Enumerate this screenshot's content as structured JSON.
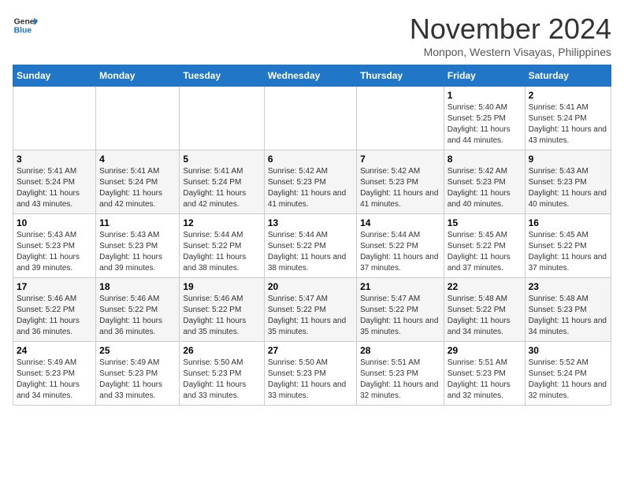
{
  "logo": {
    "line1": "General",
    "line2": "Blue"
  },
  "title": "November 2024",
  "location": "Monpon, Western Visayas, Philippines",
  "weekdays": [
    "Sunday",
    "Monday",
    "Tuesday",
    "Wednesday",
    "Thursday",
    "Friday",
    "Saturday"
  ],
  "weeks": [
    [
      {
        "day": "",
        "info": ""
      },
      {
        "day": "",
        "info": ""
      },
      {
        "day": "",
        "info": ""
      },
      {
        "day": "",
        "info": ""
      },
      {
        "day": "",
        "info": ""
      },
      {
        "day": "1",
        "info": "Sunrise: 5:40 AM\nSunset: 5:25 PM\nDaylight: 11 hours and 44 minutes."
      },
      {
        "day": "2",
        "info": "Sunrise: 5:41 AM\nSunset: 5:24 PM\nDaylight: 11 hours and 43 minutes."
      }
    ],
    [
      {
        "day": "3",
        "info": "Sunrise: 5:41 AM\nSunset: 5:24 PM\nDaylight: 11 hours and 43 minutes."
      },
      {
        "day": "4",
        "info": "Sunrise: 5:41 AM\nSunset: 5:24 PM\nDaylight: 11 hours and 42 minutes."
      },
      {
        "day": "5",
        "info": "Sunrise: 5:41 AM\nSunset: 5:24 PM\nDaylight: 11 hours and 42 minutes."
      },
      {
        "day": "6",
        "info": "Sunrise: 5:42 AM\nSunset: 5:23 PM\nDaylight: 11 hours and 41 minutes."
      },
      {
        "day": "7",
        "info": "Sunrise: 5:42 AM\nSunset: 5:23 PM\nDaylight: 11 hours and 41 minutes."
      },
      {
        "day": "8",
        "info": "Sunrise: 5:42 AM\nSunset: 5:23 PM\nDaylight: 11 hours and 40 minutes."
      },
      {
        "day": "9",
        "info": "Sunrise: 5:43 AM\nSunset: 5:23 PM\nDaylight: 11 hours and 40 minutes."
      }
    ],
    [
      {
        "day": "10",
        "info": "Sunrise: 5:43 AM\nSunset: 5:23 PM\nDaylight: 11 hours and 39 minutes."
      },
      {
        "day": "11",
        "info": "Sunrise: 5:43 AM\nSunset: 5:23 PM\nDaylight: 11 hours and 39 minutes."
      },
      {
        "day": "12",
        "info": "Sunrise: 5:44 AM\nSunset: 5:22 PM\nDaylight: 11 hours and 38 minutes."
      },
      {
        "day": "13",
        "info": "Sunrise: 5:44 AM\nSunset: 5:22 PM\nDaylight: 11 hours and 38 minutes."
      },
      {
        "day": "14",
        "info": "Sunrise: 5:44 AM\nSunset: 5:22 PM\nDaylight: 11 hours and 37 minutes."
      },
      {
        "day": "15",
        "info": "Sunrise: 5:45 AM\nSunset: 5:22 PM\nDaylight: 11 hours and 37 minutes."
      },
      {
        "day": "16",
        "info": "Sunrise: 5:45 AM\nSunset: 5:22 PM\nDaylight: 11 hours and 37 minutes."
      }
    ],
    [
      {
        "day": "17",
        "info": "Sunrise: 5:46 AM\nSunset: 5:22 PM\nDaylight: 11 hours and 36 minutes."
      },
      {
        "day": "18",
        "info": "Sunrise: 5:46 AM\nSunset: 5:22 PM\nDaylight: 11 hours and 36 minutes."
      },
      {
        "day": "19",
        "info": "Sunrise: 5:46 AM\nSunset: 5:22 PM\nDaylight: 11 hours and 35 minutes."
      },
      {
        "day": "20",
        "info": "Sunrise: 5:47 AM\nSunset: 5:22 PM\nDaylight: 11 hours and 35 minutes."
      },
      {
        "day": "21",
        "info": "Sunrise: 5:47 AM\nSunset: 5:22 PM\nDaylight: 11 hours and 35 minutes."
      },
      {
        "day": "22",
        "info": "Sunrise: 5:48 AM\nSunset: 5:22 PM\nDaylight: 11 hours and 34 minutes."
      },
      {
        "day": "23",
        "info": "Sunrise: 5:48 AM\nSunset: 5:23 PM\nDaylight: 11 hours and 34 minutes."
      }
    ],
    [
      {
        "day": "24",
        "info": "Sunrise: 5:49 AM\nSunset: 5:23 PM\nDaylight: 11 hours and 34 minutes."
      },
      {
        "day": "25",
        "info": "Sunrise: 5:49 AM\nSunset: 5:23 PM\nDaylight: 11 hours and 33 minutes."
      },
      {
        "day": "26",
        "info": "Sunrise: 5:50 AM\nSunset: 5:23 PM\nDaylight: 11 hours and 33 minutes."
      },
      {
        "day": "27",
        "info": "Sunrise: 5:50 AM\nSunset: 5:23 PM\nDaylight: 11 hours and 33 minutes."
      },
      {
        "day": "28",
        "info": "Sunrise: 5:51 AM\nSunset: 5:23 PM\nDaylight: 11 hours and 32 minutes."
      },
      {
        "day": "29",
        "info": "Sunrise: 5:51 AM\nSunset: 5:23 PM\nDaylight: 11 hours and 32 minutes."
      },
      {
        "day": "30",
        "info": "Sunrise: 5:52 AM\nSunset: 5:24 PM\nDaylight: 11 hours and 32 minutes."
      }
    ]
  ]
}
